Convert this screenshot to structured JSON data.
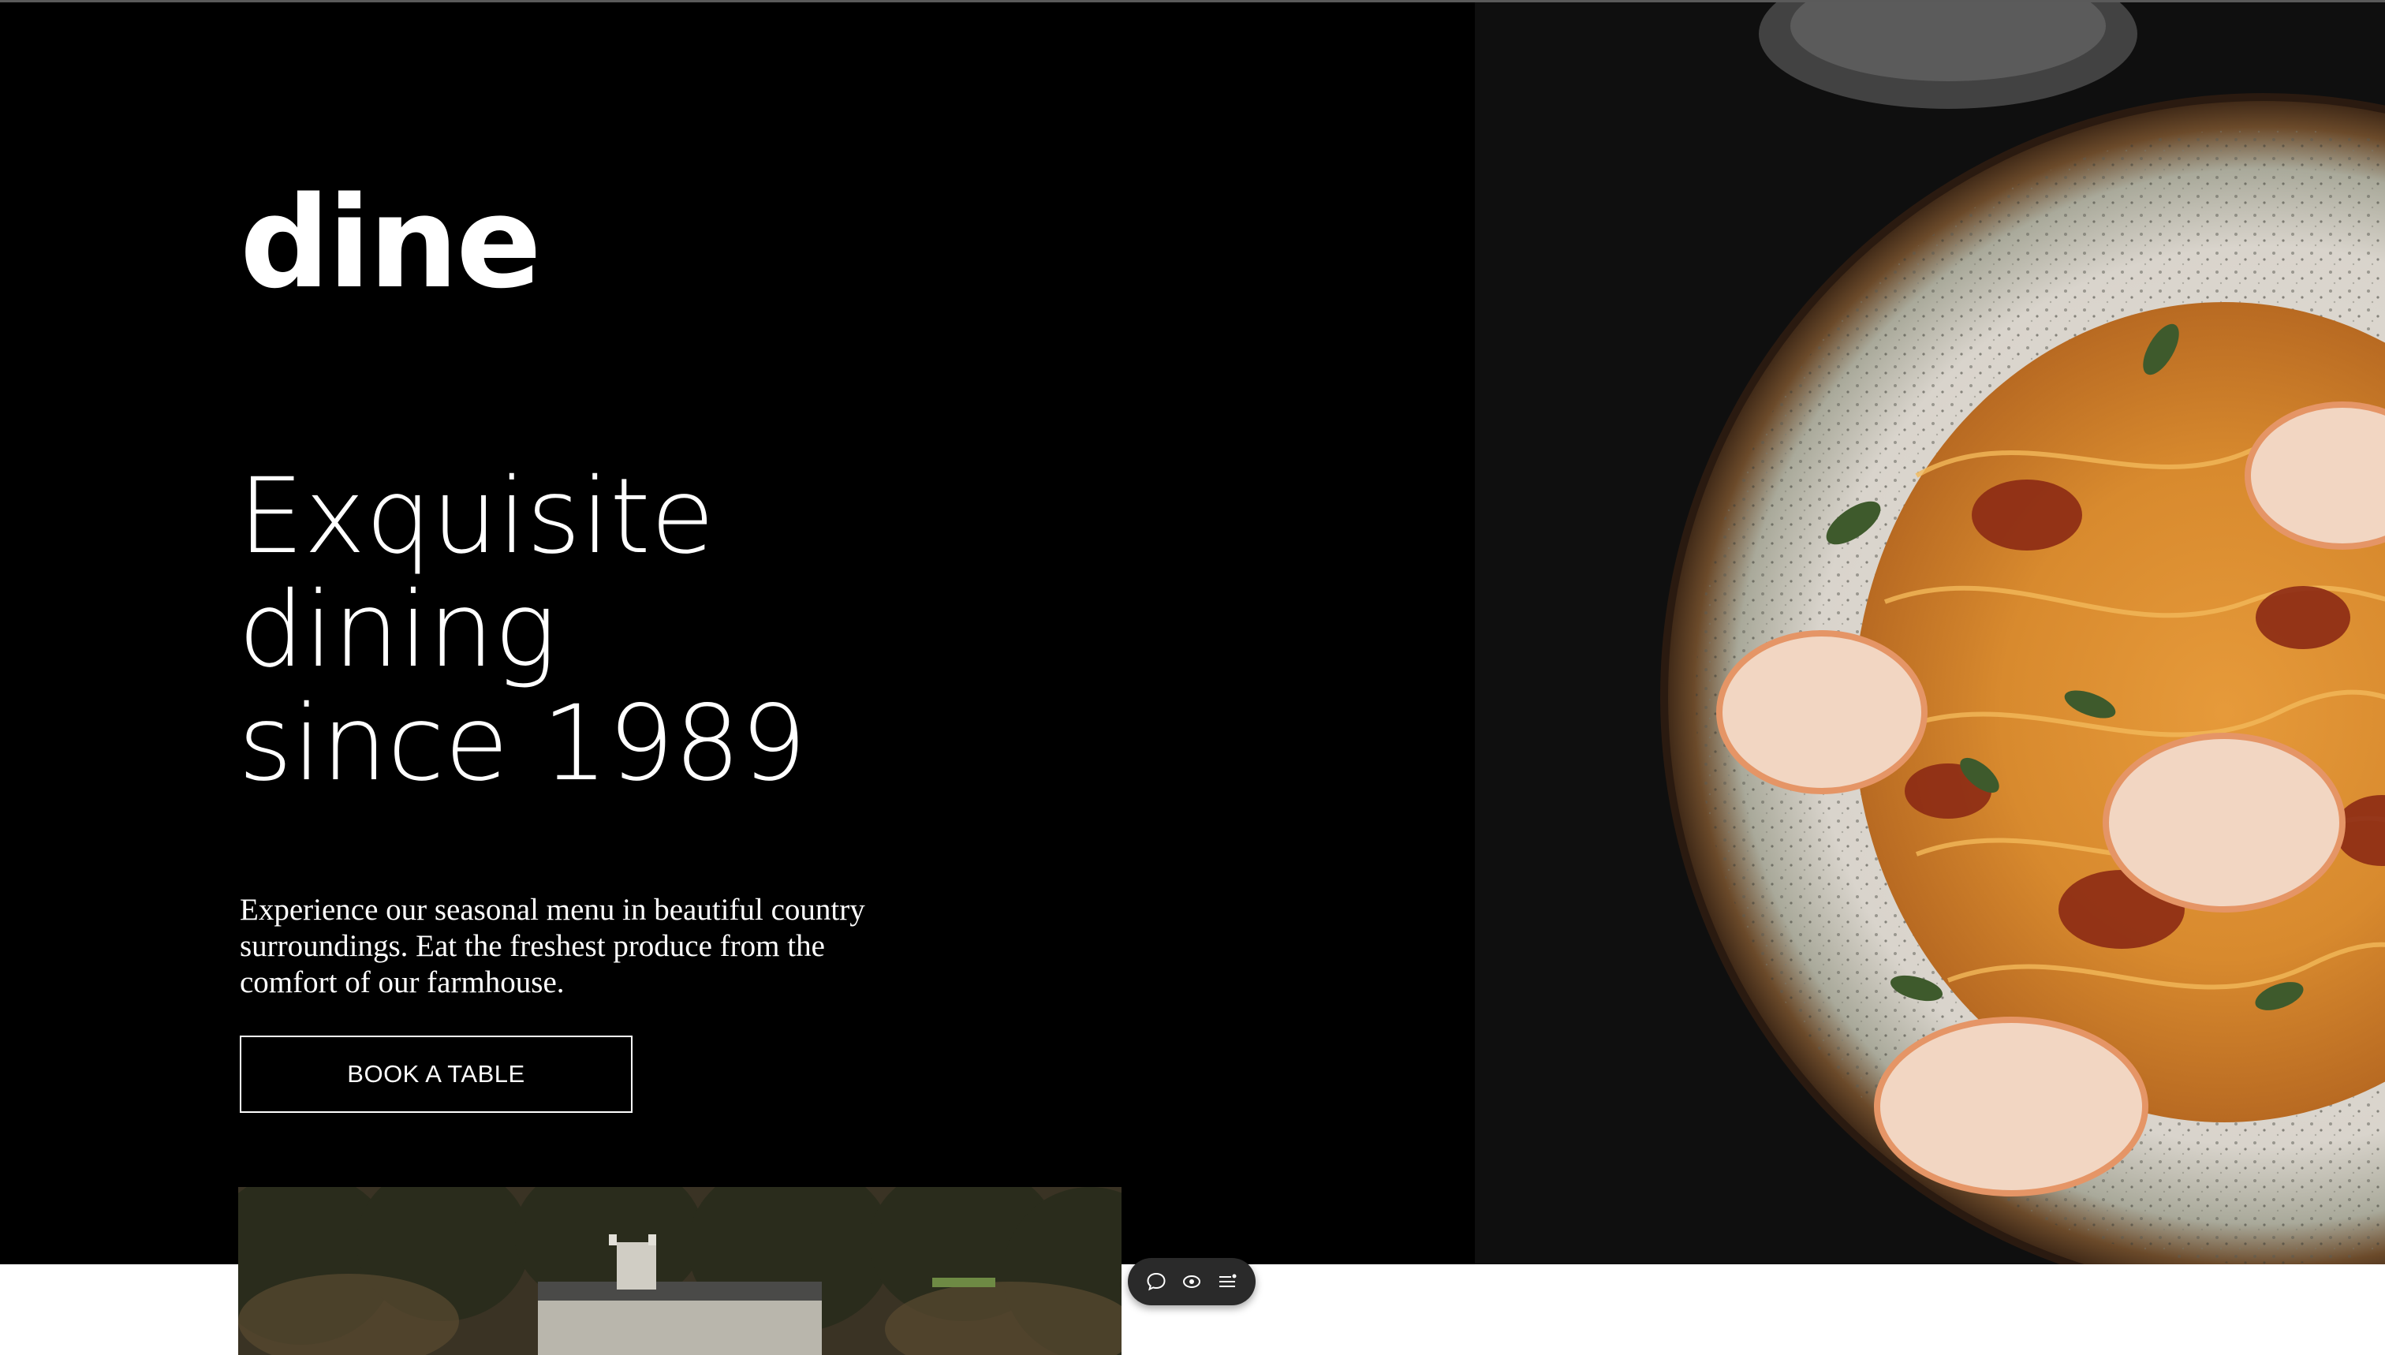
{
  "brand": {
    "logo_text": "dine"
  },
  "hero": {
    "headline_lines": [
      "Exquisite",
      "dining",
      "since 1989"
    ],
    "description": "Experience our seasonal menu in beautiful country surroundings. Eat the freshest produce from the comfort of our farmhouse.",
    "cta_label": "BOOK A TABLE"
  },
  "images": {
    "hero_dish": "plate-of-shrimp-pasta",
    "farmhouse": "farmhouse-among-trees"
  },
  "toolbar": {
    "icons": [
      "comment-icon",
      "eye-icon",
      "menu-list-icon"
    ]
  },
  "colors": {
    "background": "#000000",
    "text": "#ffffff",
    "page": "#ffffff"
  }
}
